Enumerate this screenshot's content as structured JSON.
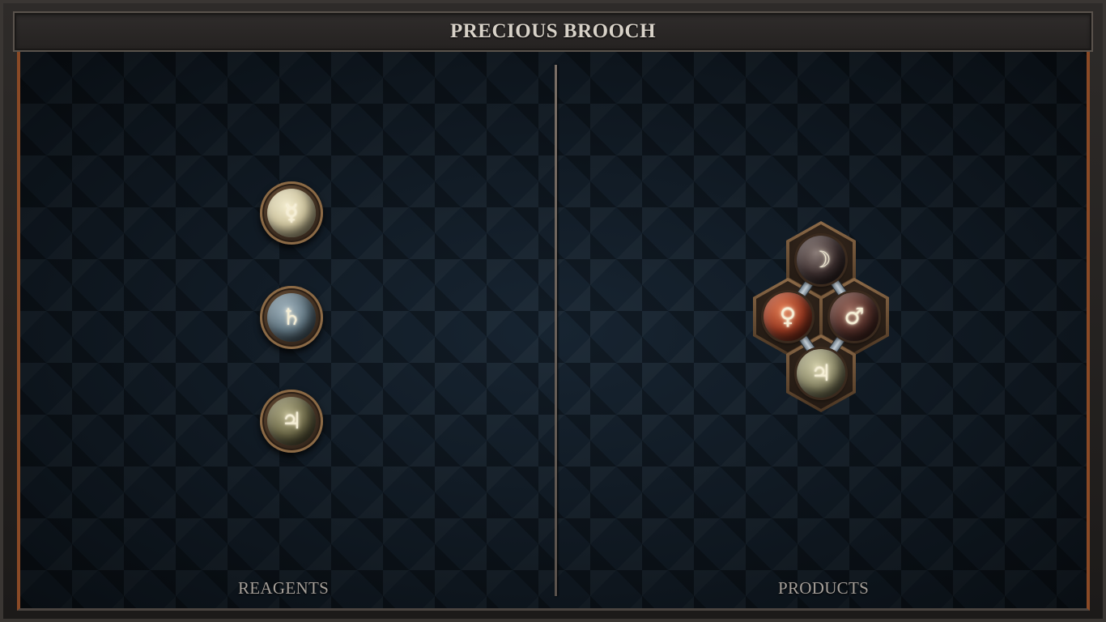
{
  "header": {
    "title": "PRECIOUS BROOCH"
  },
  "reagents": {
    "label": "REAGENTS",
    "items": [
      {
        "element": "quicksilver",
        "symbol": "☿",
        "color": "#d7cfae"
      },
      {
        "element": "lead",
        "symbol": "♄",
        "color": "#6e8490"
      },
      {
        "element": "tin",
        "symbol": "♃",
        "color": "#6f6b4a"
      }
    ]
  },
  "products": {
    "label": "PRODUCTS",
    "molecule": {
      "atoms": [
        {
          "element": "silver",
          "symbol": "☽",
          "color": "#4a3a38"
        },
        {
          "element": "copper",
          "symbol": "♀",
          "color": "#9a3a22"
        },
        {
          "element": "iron",
          "symbol": "♂",
          "color": "#5a2e28"
        },
        {
          "element": "tin",
          "symbol": "♃",
          "color": "#8c8a68"
        }
      ]
    }
  }
}
